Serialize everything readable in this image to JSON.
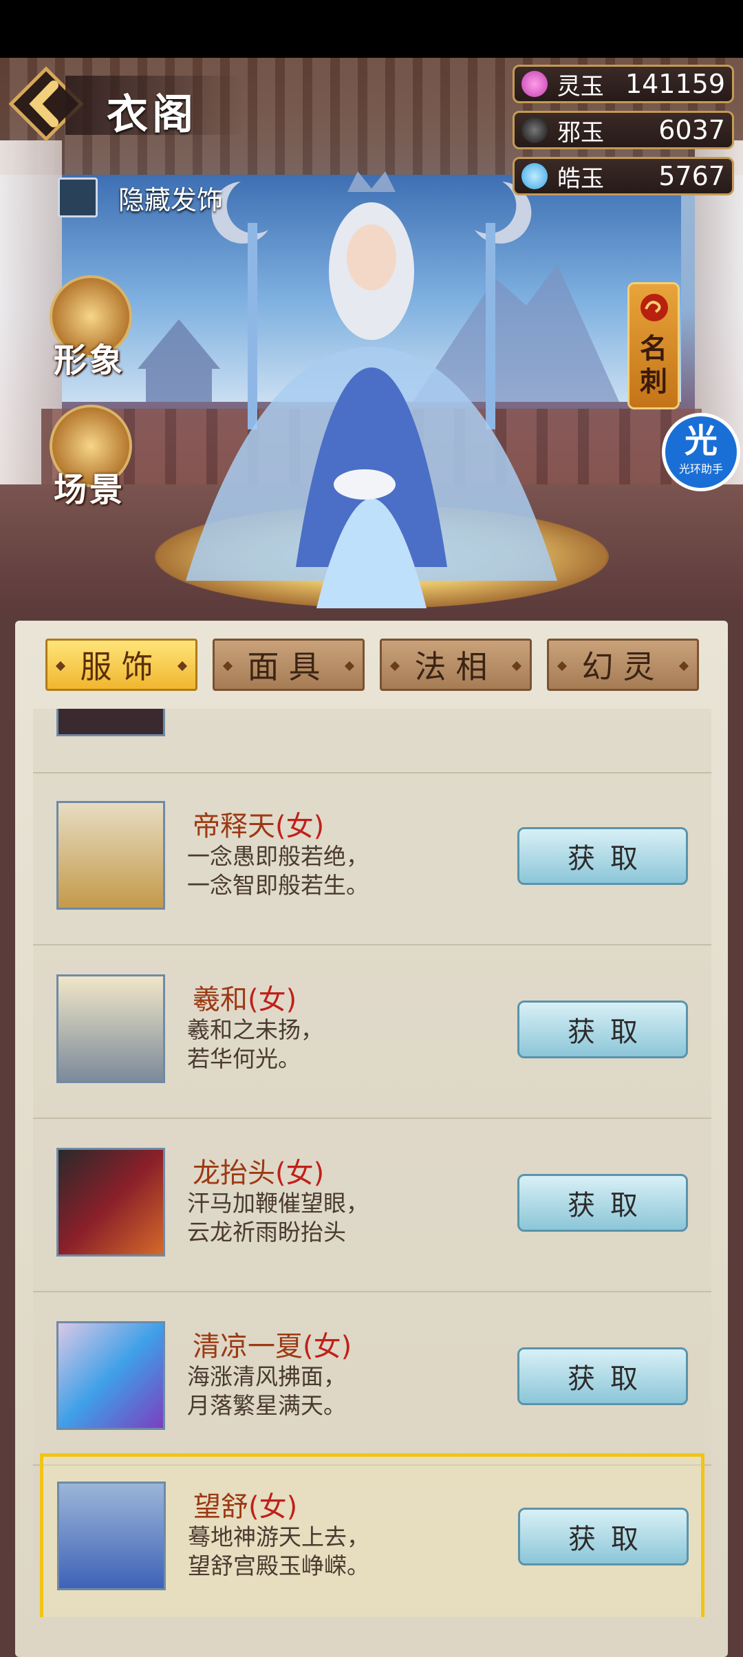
{
  "header": {
    "title": "衣阁",
    "hide_accessories_label": "隐藏发饰"
  },
  "currencies": [
    {
      "name": "灵玉",
      "value": "141159",
      "color": "#c040b0"
    },
    {
      "name": "邪玉",
      "value": "6037",
      "color": "#2a2a2a"
    },
    {
      "name": "皓玉",
      "value": "5767",
      "color": "#3aa6e6"
    }
  ],
  "side_buttons": {
    "appearance_label": "形象",
    "scene_label": "场景",
    "card_label": "名刺"
  },
  "assistant_badge": {
    "icon_text": "光",
    "label": "光环助手"
  },
  "tabs": [
    {
      "label": "服饰",
      "active": true
    },
    {
      "label": "面具",
      "active": false
    },
    {
      "label": "法相",
      "active": false
    },
    {
      "label": "幻灵",
      "active": false
    }
  ],
  "items": [
    {
      "name": "帝释天",
      "gender": "(女)",
      "line1": "一念愚即般若绝，",
      "line2": "一念智即般若生。",
      "button": "获取",
      "selected": false
    },
    {
      "name": "羲和",
      "gender": "(女)",
      "line1": "羲和之未扬，",
      "line2": "若华何光。",
      "button": "获取",
      "selected": false
    },
    {
      "name": "龙抬头",
      "gender": "(女)",
      "line1": "汗马加鞭催望眼，",
      "line2": "云龙祈雨盼抬头",
      "button": "获取",
      "selected": false
    },
    {
      "name": "清凉一夏",
      "gender": "(女)",
      "line1": "海涨清风拂面，",
      "line2": "月落繁星满天。",
      "button": "获取",
      "selected": false
    },
    {
      "name": "望舒",
      "gender": "(女)",
      "line1": "蓦地神游天上去，",
      "line2": "望舒宫殿玉峥嵘。",
      "button": "获取",
      "selected": true
    }
  ]
}
